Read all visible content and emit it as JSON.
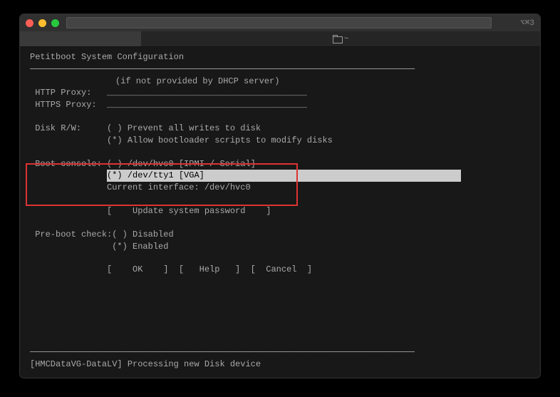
{
  "titlebar": {
    "right_indicator": "⌥⌘3"
  },
  "tabs": {
    "inactive_label": "~"
  },
  "terminal": {
    "title": "Petitboot System Configuration",
    "divider": "───────────────────────────────────────────────────────────────────────────",
    "dhcp_note": "(if not provided by DHCP server)",
    "http_proxy_label": "HTTP Proxy:",
    "https_proxy_label": "HTTPS Proxy:",
    "underline_field": "_______________________________________",
    "disk_rw_label": "Disk R/W:",
    "disk_opt1": "( ) Prevent all writes to disk",
    "disk_opt2": "(*) Allow bootloader scripts to modify disks",
    "boot_console_label": "Boot console:",
    "boot_opt1": "( ) /dev/hvc0 [IPMI / Serial]",
    "boot_opt2_prefix": "(*) /dev/tty1 [VGA]",
    "boot_current": "Current interface: /dev/hvc0",
    "update_pw": "[    Update system password    ]",
    "preboot_label": "Pre-boot check:",
    "preboot_opt1": "( ) Disabled",
    "preboot_opt2": "(*) Enabled",
    "buttons_row": "[    OK    ]  [   Help   ]  [  Cancel  ]",
    "status": "[HMCDataVG-DataLV] Processing new Disk device"
  }
}
